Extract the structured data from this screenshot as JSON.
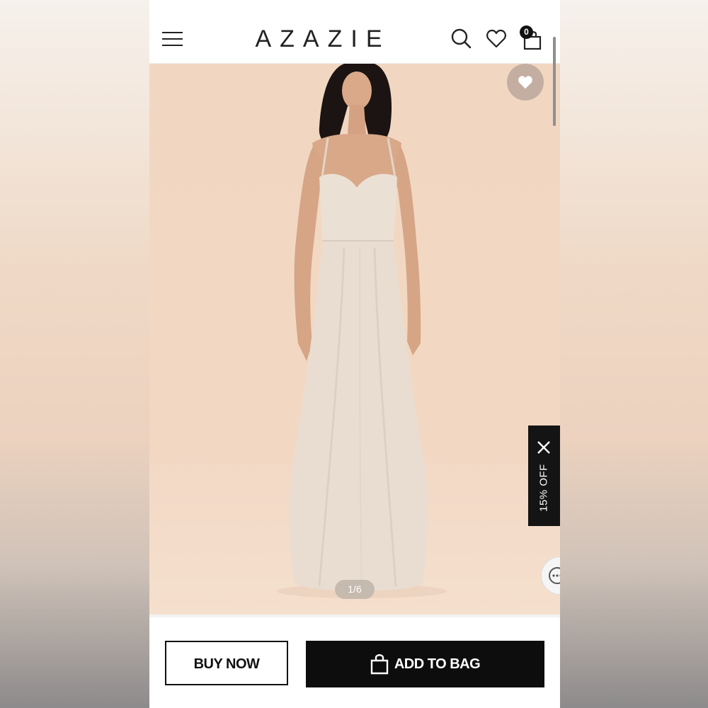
{
  "header": {
    "brand": "AZAZIE",
    "bag_count": "0",
    "icons": [
      "menu-icon",
      "search-icon",
      "heart-icon",
      "shopping-bag-icon"
    ]
  },
  "gallery": {
    "counter": "1/6",
    "favorite_icon": "heart-icon"
  },
  "promo": {
    "label": "15% OFF",
    "close_icon": "close-icon"
  },
  "chat": {
    "icon": "chat-icon"
  },
  "actions": {
    "buy_now": "BUY NOW",
    "add_to_bag": "ADD TO BAG"
  },
  "colors": {
    "primary": "#0d0d0d",
    "hero_background": "#f1d7c2",
    "dress": "#e9ddd1"
  }
}
